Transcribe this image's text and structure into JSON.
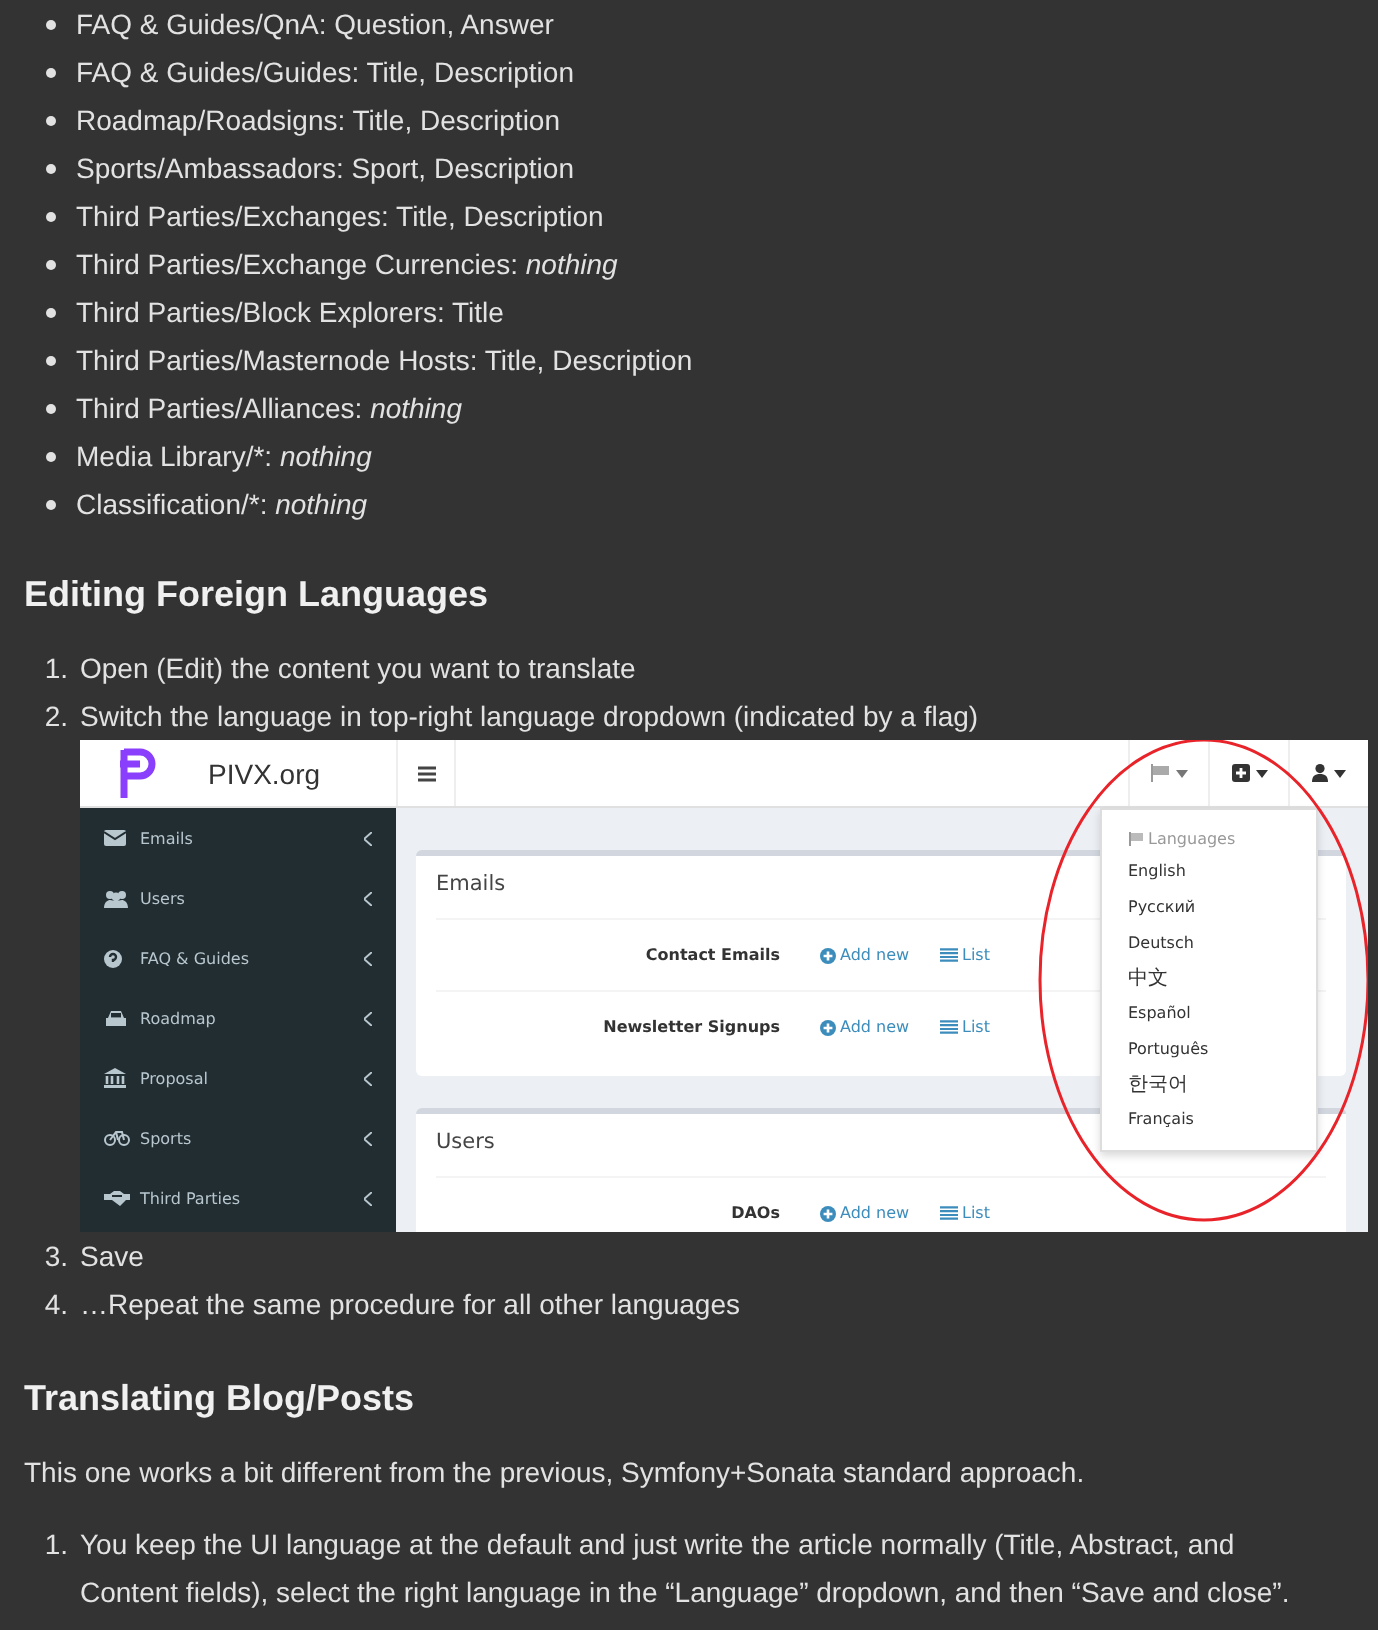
{
  "field_list": [
    {
      "text": "FAQ & Guides/QnA: Question, Answer"
    },
    {
      "text": "FAQ & Guides/Guides: Title, Description"
    },
    {
      "text": "Roadmap/Roadsigns: Title, Description"
    },
    {
      "text": "Sports/Ambassadors: Sport, Description"
    },
    {
      "text": "Third Parties/Exchanges: Title, Description"
    },
    {
      "text": "Third Parties/Exchange Currencies: *nothing*"
    },
    {
      "text": "Third Parties/Block Explorers: Title"
    },
    {
      "text": "Third Parties/Masternode Hosts: Title, Description"
    },
    {
      "text": "Third Parties/Alliances: *nothing*"
    },
    {
      "text": "Media Library/*: *nothing*"
    },
    {
      "text": "Classification/*: *nothing*"
    }
  ],
  "section_1": {
    "heading": "Editing Foreign Languages",
    "steps_before": [
      {
        "number": "1.",
        "text": "Open (Edit) the content you want to translate"
      },
      {
        "number": "2.",
        "text": "Switch the language in top-right language dropdown (indicated by a flag)"
      }
    ],
    "screenshot": {
      "site_title": "PIVX.org",
      "sidebar_items": [
        {
          "label": "Emails"
        },
        {
          "label": "Users"
        },
        {
          "label": "FAQ & Guides"
        },
        {
          "label": "Roadmap"
        },
        {
          "label": "Proposal"
        },
        {
          "label": "Sports"
        },
        {
          "label": "Third Parties"
        }
      ],
      "panels": [
        {
          "title": "Emails",
          "rows": [
            {
              "label": "Contact Emails",
              "add": "Add new",
              "list": "List"
            },
            {
              "label": "Newsletter Signups",
              "add": "Add new",
              "list": "List"
            }
          ]
        },
        {
          "title": "Users",
          "rows": [
            {
              "label": "DAOs",
              "add": "Add new",
              "list": "List"
            }
          ]
        }
      ],
      "dropdown": {
        "header": "Languages",
        "options": [
          {
            "label": "English"
          },
          {
            "label": "Русский"
          },
          {
            "label": "Deutsch"
          },
          {
            "label": "中文"
          },
          {
            "label": "Español"
          },
          {
            "label": "Português"
          },
          {
            "label": "한국어"
          },
          {
            "label": "Français"
          }
        ]
      }
    },
    "steps_after": [
      {
        "number": "3.",
        "text": "Save"
      },
      {
        "number": "4.",
        "text": "…Repeat the same procedure for all other languages"
      }
    ]
  },
  "section_2": {
    "heading": "Translating Blog/Posts",
    "paragraph": "This one works a bit different from the previous, Symfony+Sonata standard approach.",
    "steps": [
      {
        "number": "1.",
        "text": "You keep the UI language at the default and just write the article normally (Title, Abstract, and Content fields), select the right language in the “Language” dropdown, and then “Save and close”."
      }
    ]
  }
}
